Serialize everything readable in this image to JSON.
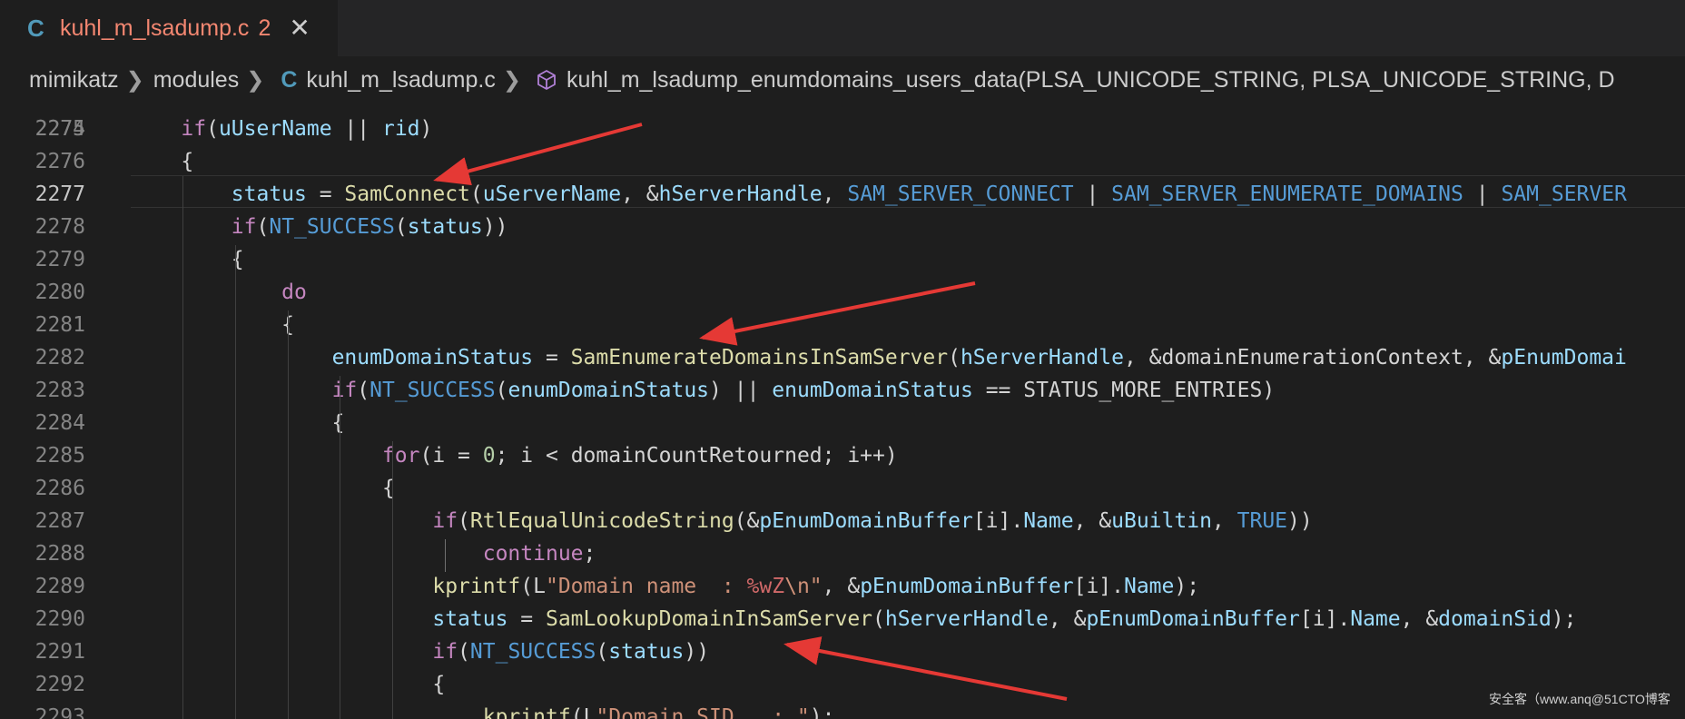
{
  "tab": {
    "lang_icon": "C",
    "title": "kuhl_m_lsadump.c",
    "problems_count": "2",
    "close_glyph": "✕"
  },
  "breadcrumb": {
    "items": [
      "mimikatz",
      "modules"
    ],
    "file_lang_icon": "C",
    "file": "kuhl_m_lsadump.c",
    "symbol_icon": "cube-icon",
    "symbol": "kuhl_m_lsadump_enumdomains_users_data(PLSA_UNICODE_STRING, PLSA_UNICODE_STRING, D"
  },
  "editor": {
    "partial_top_line": "2274",
    "active_line": "2277",
    "lines": [
      {
        "num": "2275",
        "tokens": [
          [
            "    ",
            ""
          ],
          [
            "if",
            "kw"
          ],
          [
            "(",
            ""
          ],
          [
            "uUserName",
            "var"
          ],
          [
            " || ",
            ""
          ],
          [
            "rid",
            "var"
          ],
          [
            ")",
            ""
          ]
        ]
      },
      {
        "num": "2276",
        "tokens": [
          [
            "    {",
            ""
          ]
        ]
      },
      {
        "num": "2277",
        "tokens": [
          [
            "        ",
            ""
          ],
          [
            "status",
            "var"
          ],
          [
            " = ",
            ""
          ],
          [
            "SamConnect",
            "fn"
          ],
          [
            "(",
            ""
          ],
          [
            "uServerName",
            "var"
          ],
          [
            ", &",
            ""
          ],
          [
            "hServerHandle",
            "var"
          ],
          [
            ", ",
            ""
          ],
          [
            "SAM_SERVER_CONNECT",
            "mac"
          ],
          [
            " | ",
            ""
          ],
          [
            "SAM_SERVER_ENUMERATE_DOMAINS",
            "mac"
          ],
          [
            " | ",
            ""
          ],
          [
            "SAM_SERVER",
            "mac"
          ]
        ]
      },
      {
        "num": "2278",
        "tokens": [
          [
            "        ",
            ""
          ],
          [
            "if",
            "kw"
          ],
          [
            "(",
            ""
          ],
          [
            "NT_SUCCESS",
            "mac"
          ],
          [
            "(",
            ""
          ],
          [
            "status",
            "var"
          ],
          [
            "))",
            ""
          ]
        ]
      },
      {
        "num": "2279",
        "tokens": [
          [
            "        {",
            ""
          ]
        ]
      },
      {
        "num": "2280",
        "tokens": [
          [
            "            ",
            ""
          ],
          [
            "do",
            "kw"
          ]
        ]
      },
      {
        "num": "2281",
        "tokens": [
          [
            "            {",
            ""
          ]
        ]
      },
      {
        "num": "2282",
        "tokens": [
          [
            "                ",
            ""
          ],
          [
            "enumDomainStatus",
            "var"
          ],
          [
            " = ",
            ""
          ],
          [
            "SamEnumerateDomainsInSamServer",
            "fn"
          ],
          [
            "(",
            ""
          ],
          [
            "hServerHandle",
            "var"
          ],
          [
            ", &domainEnumerationContext, &",
            ""
          ],
          [
            "pEnumDomai",
            "var"
          ]
        ]
      },
      {
        "num": "2283",
        "tokens": [
          [
            "                ",
            ""
          ],
          [
            "if",
            "kw"
          ],
          [
            "(",
            ""
          ],
          [
            "NT_SUCCESS",
            "mac"
          ],
          [
            "(",
            ""
          ],
          [
            "enumDomainStatus",
            "var"
          ],
          [
            ") || ",
            ""
          ],
          [
            "enumDomainStatus",
            "var"
          ],
          [
            " == STATUS_MORE_ENTRIES)",
            ""
          ]
        ]
      },
      {
        "num": "2284",
        "tokens": [
          [
            "                {",
            ""
          ]
        ]
      },
      {
        "num": "2285",
        "tokens": [
          [
            "                    ",
            ""
          ],
          [
            "for",
            "kw"
          ],
          [
            "(i = ",
            ""
          ],
          [
            "0",
            "num"
          ],
          [
            "; i < domainCountRetourned; i++)",
            ""
          ]
        ]
      },
      {
        "num": "2286",
        "tokens": [
          [
            "                    {",
            ""
          ]
        ]
      },
      {
        "num": "2287",
        "tokens": [
          [
            "                        ",
            ""
          ],
          [
            "if",
            "kw"
          ],
          [
            "(",
            ""
          ],
          [
            "RtlEqualUnicodeString",
            "fn"
          ],
          [
            "(&",
            ""
          ],
          [
            "pEnumDomainBuffer",
            "var"
          ],
          [
            "[i].",
            ""
          ],
          [
            "Name",
            "var"
          ],
          [
            ", &",
            ""
          ],
          [
            "uBuiltin",
            "var"
          ],
          [
            ", ",
            ""
          ],
          [
            "TRUE",
            "mac"
          ],
          [
            "))",
            ""
          ]
        ]
      },
      {
        "num": "2288",
        "tokens": [
          [
            "                            ",
            ""
          ],
          [
            "continue",
            "kw"
          ],
          [
            ";",
            ""
          ]
        ]
      },
      {
        "num": "2289",
        "tokens": [
          [
            "                        ",
            ""
          ],
          [
            "kprintf",
            "fn"
          ],
          [
            "(L",
            ""
          ],
          [
            "\"Domain name  : ",
            "str"
          ],
          [
            "%wZ",
            "fmt"
          ],
          [
            "\\n\"",
            "str"
          ],
          [
            ", &",
            ""
          ],
          [
            "pEnumDomainBuffer",
            "var"
          ],
          [
            "[i].",
            ""
          ],
          [
            "Name",
            "var"
          ],
          [
            ");",
            ""
          ]
        ]
      },
      {
        "num": "2290",
        "tokens": [
          [
            "                        ",
            ""
          ],
          [
            "status",
            "var"
          ],
          [
            " = ",
            ""
          ],
          [
            "SamLookupDomainInSamServer",
            "fn"
          ],
          [
            "(",
            ""
          ],
          [
            "hServerHandle",
            "var"
          ],
          [
            ", &",
            ""
          ],
          [
            "pEnumDomainBuffer",
            "var"
          ],
          [
            "[i].",
            ""
          ],
          [
            "Name",
            "var"
          ],
          [
            ", &",
            ""
          ],
          [
            "domainSid",
            "var"
          ],
          [
            ");",
            ""
          ]
        ]
      },
      {
        "num": "2291",
        "tokens": [
          [
            "                        ",
            ""
          ],
          [
            "if",
            "kw"
          ],
          [
            "(",
            ""
          ],
          [
            "NT_SUCCESS",
            "mac"
          ],
          [
            "(",
            ""
          ],
          [
            "status",
            "var"
          ],
          [
            "))",
            ""
          ]
        ]
      },
      {
        "num": "2292",
        "tokens": [
          [
            "                        {",
            ""
          ]
        ]
      },
      {
        "num": "2293",
        "tokens": [
          [
            "                            ",
            ""
          ],
          [
            "kprintf",
            "fn"
          ],
          [
            "(L",
            ""
          ],
          [
            "\"Domain SID   : \"",
            "str"
          ],
          [
            ");",
            ""
          ]
        ]
      }
    ]
  },
  "watermark": "安全客（www.anq@51CTO博客",
  "colors": {
    "background": "#1e1e1e",
    "tab_title": "#f48771",
    "c_icon": "#519aba",
    "arrow": "#e53935"
  }
}
